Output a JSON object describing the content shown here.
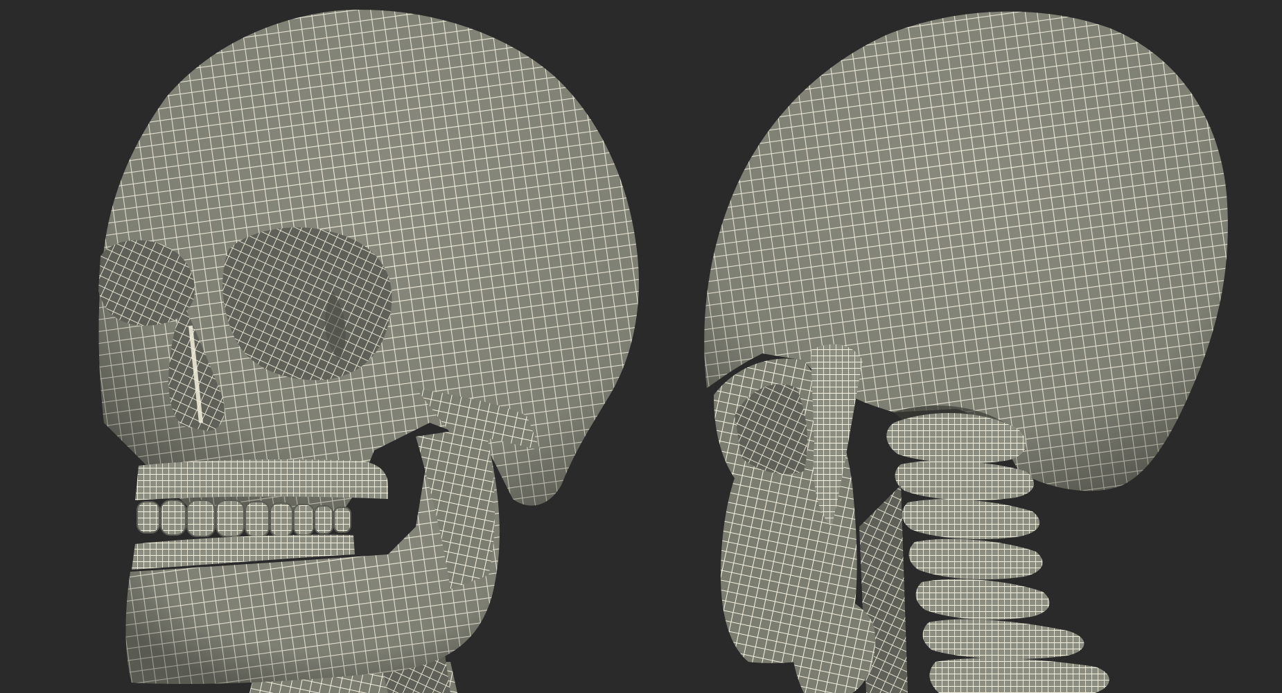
{
  "scene": {
    "background": "#2a2a2a",
    "mesh_fill": "#898a7d",
    "mesh_shade": "#55564d",
    "wire_color": "#f4f1df",
    "views": [
      {
        "id": "front-three-quarter",
        "subject": "skull-front-view"
      },
      {
        "id": "rear-three-quarter",
        "subject": "skull-back-view-with-cervical-spine"
      }
    ]
  }
}
